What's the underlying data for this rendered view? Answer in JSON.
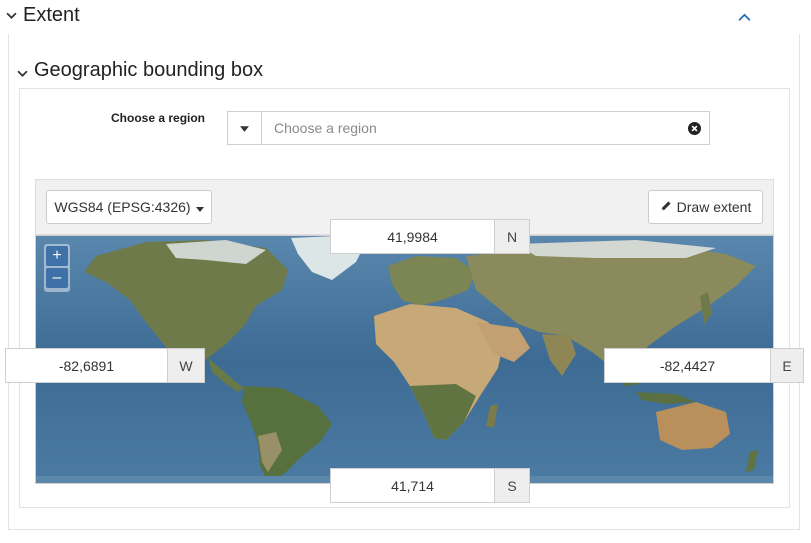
{
  "section": {
    "title": "Extent"
  },
  "subsection": {
    "title": "Geographic bounding box"
  },
  "region": {
    "label": "Choose a region",
    "placeholder": "Choose a region"
  },
  "toolbar": {
    "projection_label": "WGS84 (EPSG:4326)",
    "draw_label": "Draw extent"
  },
  "map": {
    "zoom_in": "+",
    "zoom_out": "–"
  },
  "bbox": {
    "north": {
      "value": "41,9984",
      "unit": "N"
    },
    "south": {
      "value": "41,714",
      "unit": "S"
    },
    "west": {
      "value": "-82,6891",
      "unit": "W"
    },
    "east": {
      "value": "-82,4427",
      "unit": "E"
    }
  },
  "colors": {
    "accent": "#1f6fb2",
    "ocean": "#3d6b94",
    "land": "#7b8a55",
    "desert": "#c7a877"
  },
  "icons": [
    "chevron-down-icon",
    "chevron-up-icon",
    "caret-down-icon",
    "clear-icon",
    "pencil-icon"
  ]
}
